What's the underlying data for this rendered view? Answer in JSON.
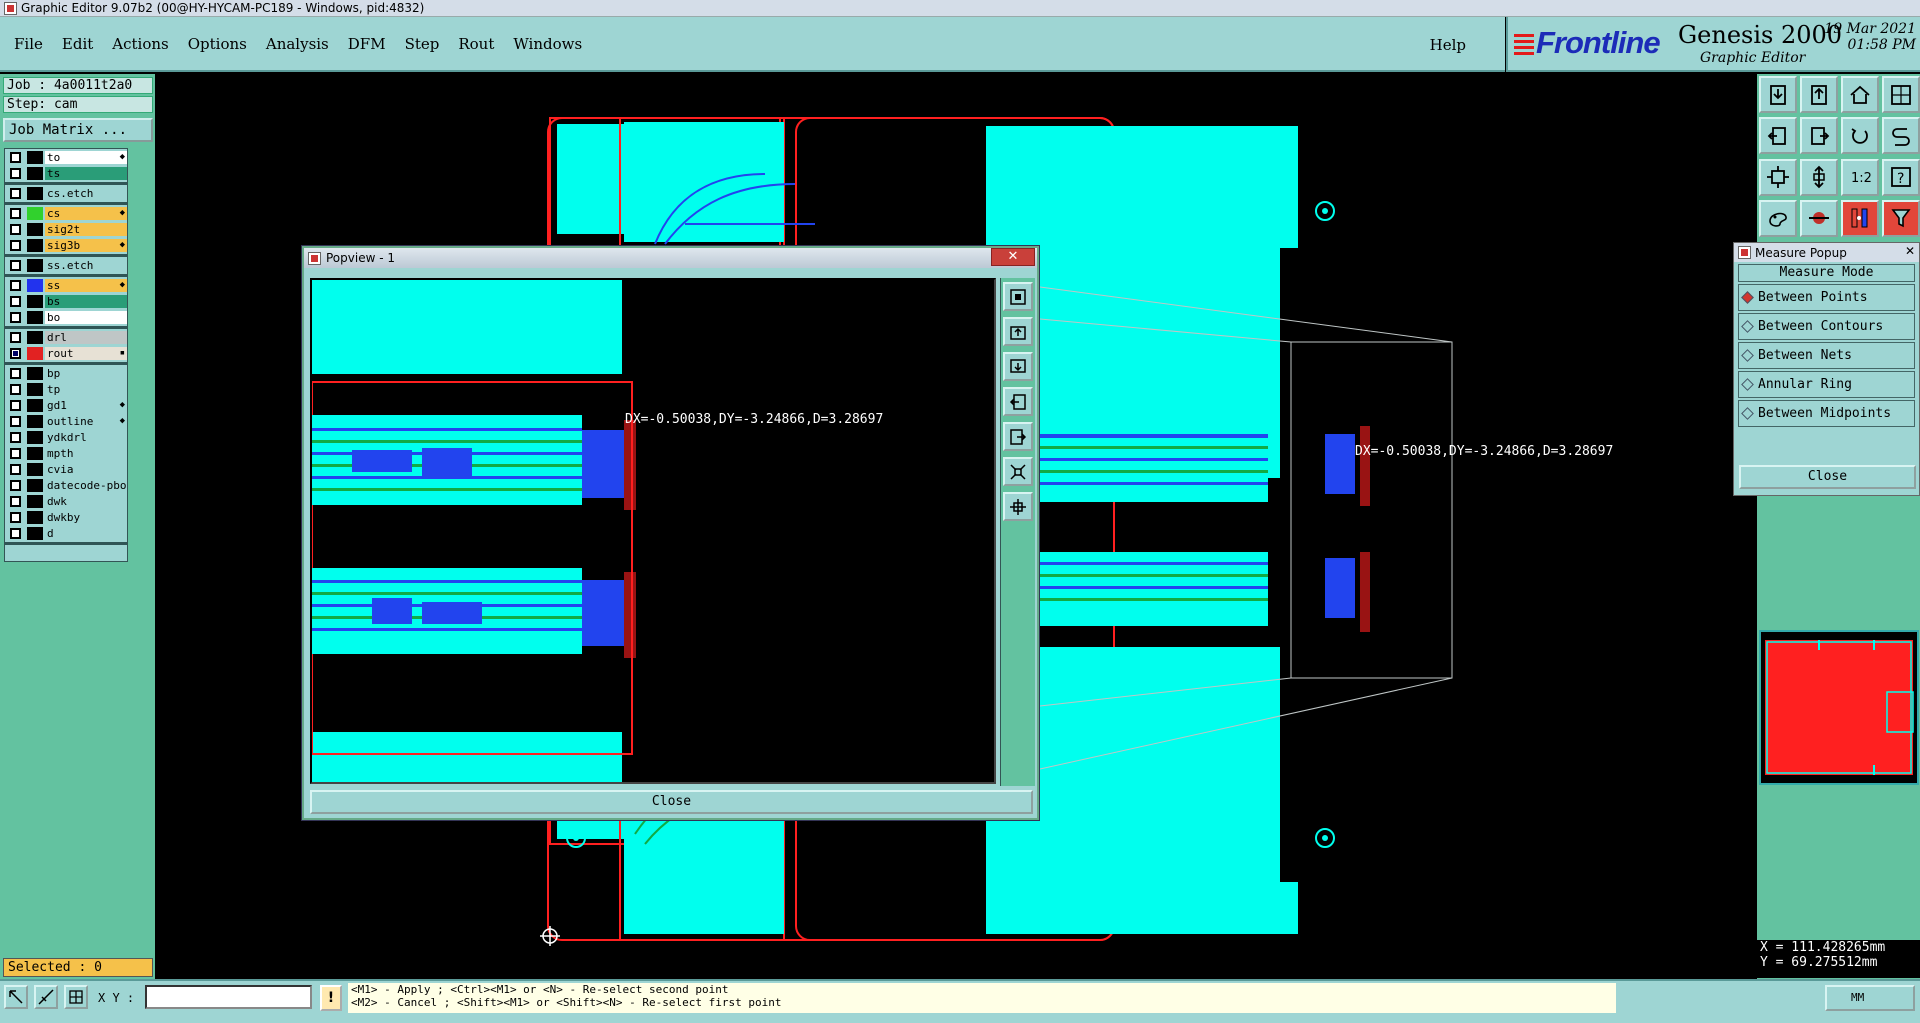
{
  "window": {
    "title": "Graphic Editor 9.07b2 (00@HY-HYCAM-PC189 - Windows, pid:4832)"
  },
  "menu": {
    "items": [
      "File",
      "Edit",
      "Actions",
      "Options",
      "Analysis",
      "DFM",
      "Step",
      "Rout",
      "Windows"
    ],
    "help": "Help"
  },
  "brand": {
    "logo": "Frontline",
    "product": "Genesis 2000",
    "subtitle": "Graphic Editor",
    "date": "19 Mar 2021",
    "time": "01:58 PM"
  },
  "job": {
    "job_label": "Job : 4a0011t2a0",
    "step_label": "Step: cam",
    "matrix_button": "Job Matrix ..."
  },
  "layers": [
    [
      {
        "name": "to",
        "color": "#ffffff",
        "flag": "◆"
      },
      {
        "name": "ts",
        "color": "#2a9d78",
        "flag": ""
      }
    ],
    [
      {
        "name": "cs.etch",
        "color": "#9ed5d3",
        "flag": ""
      }
    ],
    [
      {
        "name": "cs",
        "color": "#f5c14a",
        "flag": "◆"
      },
      {
        "name": "sig2t",
        "color": "#f5c14a",
        "flag": ""
      },
      {
        "name": "sig3b",
        "color": "#f5c14a",
        "flag": "◆"
      }
    ],
    [
      {
        "name": "ss.etch",
        "color": "#9ed5d3",
        "flag": ""
      }
    ],
    [
      {
        "name": "ss",
        "color": "#f5c14a",
        "flag": "◆"
      },
      {
        "name": "bs",
        "color": "#2a9d78",
        "flag": ""
      },
      {
        "name": "bo",
        "color": "#ffffff",
        "flag": ""
      }
    ],
    [
      {
        "name": "drl",
        "color": "#bfc6c6",
        "flag": ""
      },
      {
        "name": "rout",
        "color": "#e7e1d5",
        "flag": "▪"
      }
    ],
    [
      {
        "name": "bp",
        "color": "#9ed5d3",
        "flag": ""
      },
      {
        "name": "tp",
        "color": "#9ed5d3",
        "flag": ""
      },
      {
        "name": "gd1",
        "color": "#9ed5d3",
        "flag": "◆"
      },
      {
        "name": "outline",
        "color": "#9ed5d3",
        "flag": "◆"
      },
      {
        "name": "ydkdrl",
        "color": "#9ed5d3",
        "flag": ""
      },
      {
        "name": "mpth",
        "color": "#9ed5d3",
        "flag": ""
      },
      {
        "name": "cvia",
        "color": "#9ed5d3",
        "flag": ""
      },
      {
        "name": "datecode-pbo",
        "color": "#9ed5d3",
        "flag": ""
      },
      {
        "name": "dwk",
        "color": "#9ed5d3",
        "flag": ""
      },
      {
        "name": "dwkby",
        "color": "#9ed5d3",
        "flag": ""
      },
      {
        "name": "d",
        "color": "#9ed5d3",
        "flag": ""
      }
    ]
  ],
  "layer_swatches": [
    "#000000",
    "#000000",
    "#000000",
    "#31d12d",
    "#000000",
    "#000000",
    "#000000",
    "#2233ee",
    "#000000",
    "#000000",
    "#000000",
    "#e22222",
    "#000000",
    "#000000",
    "#000000",
    "#000000",
    "#000000",
    "#000000",
    "#000000",
    "#000000",
    "#000000",
    "#000000"
  ],
  "selected": "Selected : 0",
  "popview": {
    "title": "Popview - 1",
    "close_x": "✕",
    "close": "Close",
    "measure_text": "DX=-0.50038,DY=-3.24866,D=3.28697"
  },
  "main_measure_text": "DX=-0.50038,DY=-3.24866,D=3.28697",
  "measure_popup": {
    "title": "Measure Popup",
    "header": "Measure Mode",
    "options": [
      "Between Points",
      "Between Contours",
      "Between Nets",
      "Annular Ring",
      "Between Midpoints"
    ],
    "selected_index": 0,
    "close": "Close"
  },
  "coords": {
    "x": "X = 111.428265mm",
    "y": "Y = 69.275512mm"
  },
  "statusbar": {
    "xy_label": "X Y :",
    "xy_value": "",
    "hint_button": "!",
    "hint_line1": "<M1> - Apply  ; <Ctrl><M1> or <N> - Re-select second point",
    "hint_line2": "<M2> - Cancel ; <Shift><M1> or <Shift><N> - Re-select first point",
    "units": "MM"
  },
  "icons": {
    "toolbar": [
      "import-icon",
      "export-icon",
      "home-icon",
      "zoom-fit-icon",
      "pan-left-icon",
      "pan-right-icon",
      "rotate-icon",
      "snap-icon",
      "zoom-horizontal-icon",
      "zoom-vertical-icon",
      "scale-icon",
      "help-icon",
      "palette-icon",
      "measure-icon",
      "layers-icon",
      "filter-icon"
    ],
    "popview": [
      "zoom-icon",
      "page-up-icon",
      "page-down-icon",
      "page-left-icon",
      "page-right-icon",
      "fit-icon",
      "center-icon"
    ]
  },
  "colors": {
    "panel": "#9ed5d3",
    "panel_dark": "#63c2a0",
    "cyan": "#00ffee",
    "outline": "#ff2020",
    "highlight": "#f5c14a"
  }
}
